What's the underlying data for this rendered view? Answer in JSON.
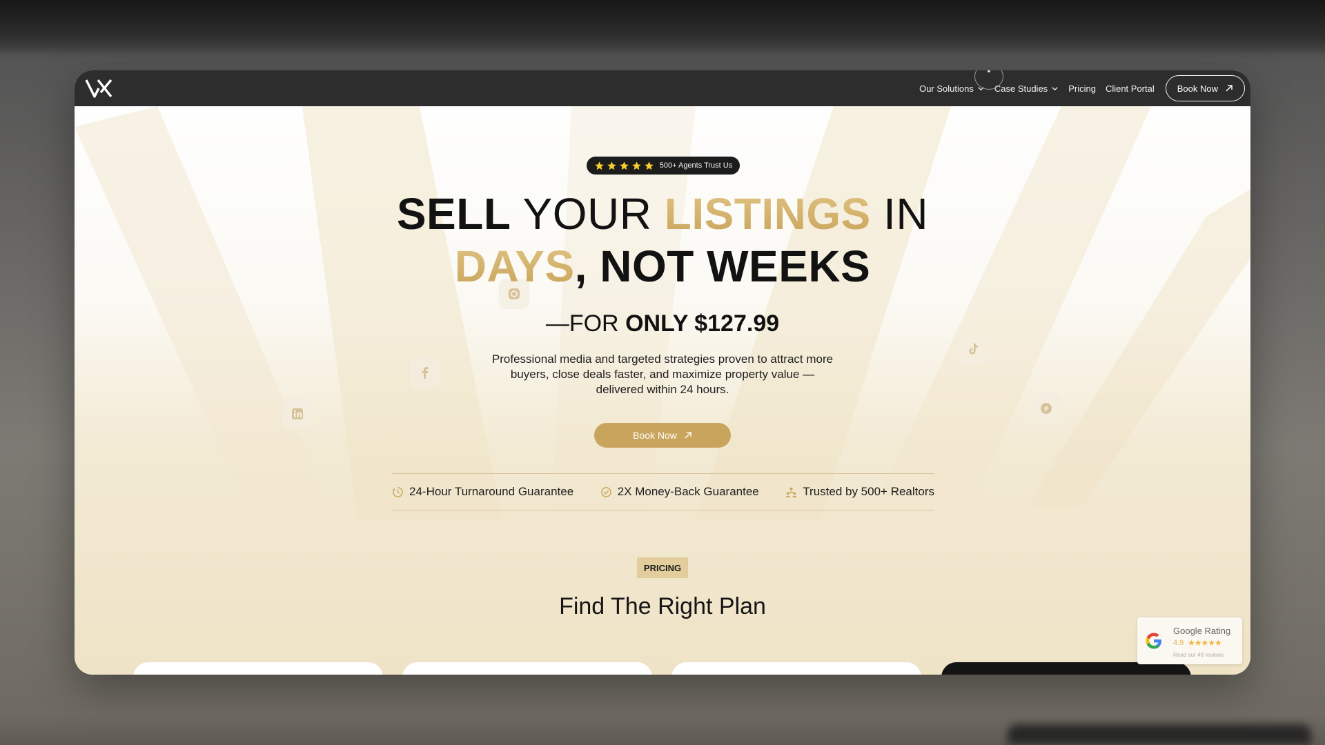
{
  "brand": {
    "logo_name": "vx-logo"
  },
  "nav": {
    "items": [
      {
        "label": "Our Solutions",
        "has_dropdown": true
      },
      {
        "label": "Case Studies",
        "has_dropdown": true
      },
      {
        "label": "Pricing",
        "has_dropdown": false
      },
      {
        "label": "Client Portal",
        "has_dropdown": false
      }
    ],
    "book_now": "Book Now"
  },
  "hero": {
    "badge_text": "500+ Agents Trust Us",
    "badge_stars": 5,
    "headline": {
      "w1": "SELL",
      "w2": "YOUR",
      "w3": "LISTINGS",
      "w4": "IN",
      "w5": "DAYS",
      "w6": ",",
      "w7": "NOT WEEKS"
    },
    "price_prefix": "—FOR",
    "price_strong": "ONLY $127.99",
    "subtitle": "Professional media and targeted strategies proven to attract more buyers, close deals faster, and maximize property value —delivered within 24 hours.",
    "cta": "Book Now"
  },
  "guarantees": [
    {
      "label": "24-Hour Turnaround Guarantee",
      "icon": "clock-icon"
    },
    {
      "label": "2X Money-Back Guarantee",
      "icon": "check-circle-icon"
    },
    {
      "label": "Trusted by 500+ Realtors",
      "icon": "people-icon"
    }
  ],
  "pricing": {
    "pill": "PRICING",
    "title": "Find The Right Plan"
  },
  "google_rating": {
    "title": "Google Rating",
    "score": "4.9",
    "stars": "★★★★★",
    "reviews": "Read our 48 reviews"
  },
  "colors": {
    "accent_gold": "#c9a45c",
    "topbar": "#2d2d2d",
    "text_dark": "#121212"
  }
}
